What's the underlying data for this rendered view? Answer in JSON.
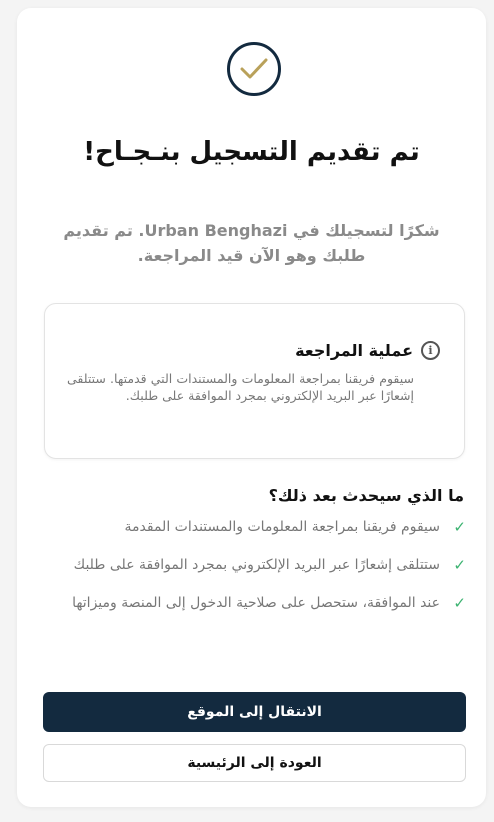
{
  "success": {
    "title": "تم تقديم التسجيل بنـجـاح!",
    "subtitle": "شكرًا لتسجيلك في Urban Benghazi. تم تقديم طلبك وهو الآن قيد المراجعة."
  },
  "review": {
    "title": "عملية المراجعة",
    "icon": "info-icon",
    "body": "سيقوم فريقنا بمراجعة المعلومات والمستندات التي قدمتها. ستتلقى إشعارًا عبر البريد الإلكتروني بمجرد الموافقة على طلبك."
  },
  "next_steps": {
    "heading": "ما الذي سيحدث بعد ذلك؟",
    "items": [
      "سيقوم فريقنا بمراجعة المعلومات والمستندات المقدمة",
      "ستتلقى إشعارًا عبر البريد الإلكتروني بمجرد الموافقة على طلبك",
      "عند الموافقة، ستحصل على صلاحية الدخول إلى المنصة وميزاتها"
    ]
  },
  "buttons": {
    "go_to_site": "الانتقال إلى الموقع",
    "back_home": "العودة إلى الرئيسية"
  },
  "colors": {
    "primary": "#132a3f",
    "check_accent": "#b9a15a",
    "tick_green": "#3cb371"
  }
}
